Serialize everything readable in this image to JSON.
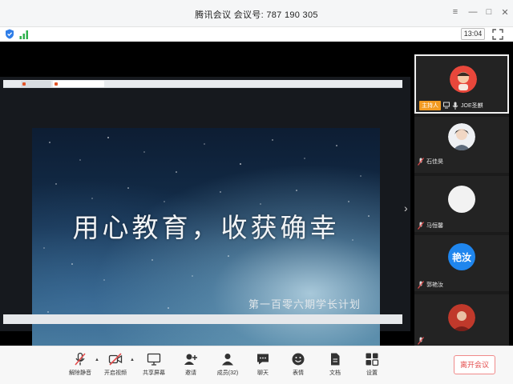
{
  "window": {
    "title": "腾讯会议 会议号: 787 190 305",
    "controls": {
      "menu": "≡",
      "minimize": "—",
      "maximize": "□",
      "close": "✕"
    }
  },
  "infobar": {
    "time": "13:04",
    "icons": [
      "shield-icon",
      "signal-icon",
      "fullscreen-icon"
    ]
  },
  "slide": {
    "title": "用心教育，收获确幸",
    "subtitle": "第一百零六期学长计划"
  },
  "participants": [
    {
      "role": "主持人",
      "name": "JOE圣麒",
      "avatar": "cartoon"
    },
    {
      "name": "石佳昊",
      "avatar": "photo"
    },
    {
      "name": "马恒馨",
      "avatar": "blank"
    },
    {
      "name": "郭艳汝",
      "avatar_text": "艳汝",
      "avatar_color": "#1f86ee"
    },
    {
      "name": "",
      "avatar": "photo-red"
    }
  ],
  "toolbar": {
    "items": [
      {
        "label": "解除静音",
        "icon": "mic-muted-icon"
      },
      {
        "label": "开启视频",
        "icon": "video-off-icon"
      },
      {
        "label": "共享屏幕",
        "icon": "screen-share-icon"
      },
      {
        "label": "邀请",
        "icon": "invite-icon"
      },
      {
        "label": "成员(32)",
        "icon": "members-icon"
      },
      {
        "label": "聊天",
        "icon": "chat-icon"
      },
      {
        "label": "表情",
        "icon": "emoji-icon"
      },
      {
        "label": "文档",
        "icon": "document-icon"
      },
      {
        "label": "设置",
        "icon": "settings-icon"
      }
    ],
    "leave_label": "离开会议"
  },
  "colors": {
    "accent_orange": "#f29b22",
    "leave_red": "#e44d4d",
    "avatar_blue": "#1f86ee",
    "avatar_red": "#e8473b"
  }
}
